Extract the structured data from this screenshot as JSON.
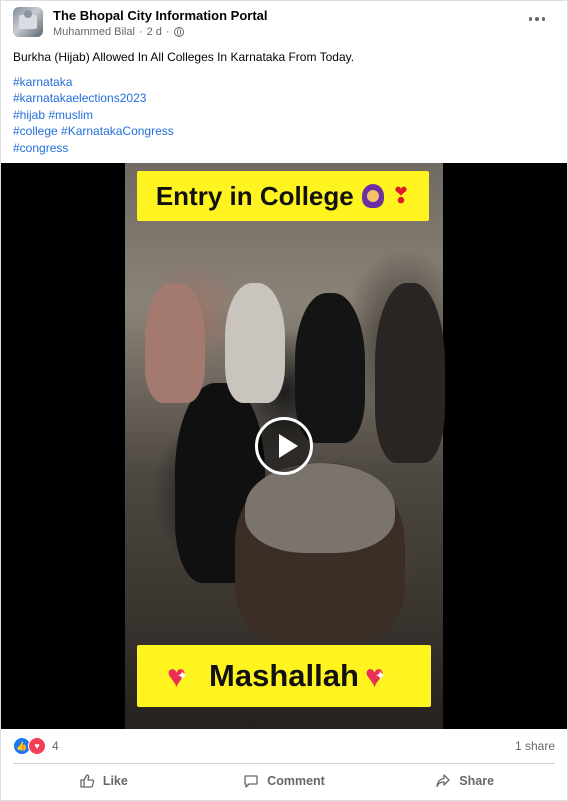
{
  "post": {
    "page_name": "The Bhopal City Information Portal",
    "author": "Muhammed Bilal",
    "time_sep": "·",
    "time": "2 d",
    "time_sep2": "·",
    "caption": "Burkha (Hijab) Allowed In All Colleges In Karnataka From Today.",
    "hashtag_lines": [
      "#karnataka",
      "#karnatakaelections2023",
      "#hijab #muslim",
      "#college #KarnatakaCongress",
      "#congress"
    ]
  },
  "video": {
    "banner_top": "Entry in College",
    "banner_bottom": "Mashallah",
    "top_emojis": [
      "hijab-woman-icon",
      "heart-icon"
    ],
    "bottom_emojis": [
      "sparkling-heart-icon",
      "sparkling-heart-icon"
    ]
  },
  "stats": {
    "reaction_icons": [
      "like-icon",
      "love-icon"
    ],
    "reaction_count": "4",
    "share_count": "1 share"
  },
  "actions": {
    "like": "Like",
    "comment": "Comment",
    "share": "Share"
  },
  "colors": {
    "link": "#216fdb",
    "secondary_text": "#65676b",
    "banner_yellow": "#fff41f",
    "like_blue": "#1877f2",
    "love_red": "#f33e58"
  }
}
